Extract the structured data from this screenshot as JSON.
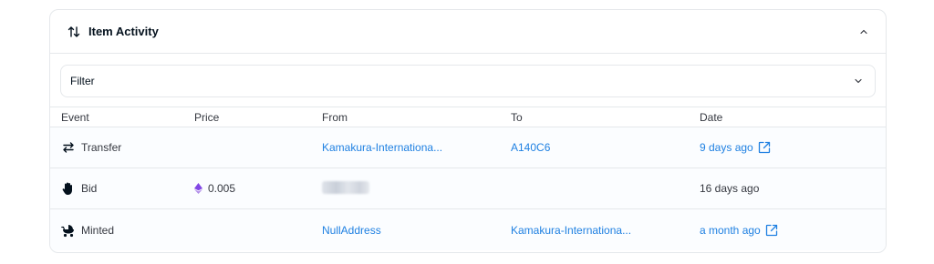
{
  "panel": {
    "title": "Item Activity",
    "header_icon": "swap-vertical-icon",
    "collapse_icon": "chevron-up-icon"
  },
  "filter": {
    "label": "Filter",
    "icon": "chevron-down-icon"
  },
  "columns": [
    "Event",
    "Price",
    "From",
    "To",
    "Date"
  ],
  "rows": [
    {
      "event": "Transfer",
      "event_icon": "transfer-arrows-icon",
      "price": "",
      "from": "Kamakura-Internationa...",
      "to": "A140C6",
      "date": "9 days ago",
      "date_has_link": true
    },
    {
      "event": "Bid",
      "event_icon": "hand-icon",
      "price": "0.005",
      "price_icon": "ethereum-icon",
      "from": "",
      "from_redacted": true,
      "to": "",
      "date": "16 days ago",
      "date_has_link": false
    },
    {
      "event": "Minted",
      "event_icon": "stroller-icon",
      "price": "",
      "from": "NullAddress",
      "to": "Kamakura-Internationa...",
      "date": "a month ago",
      "date_has_link": true
    }
  ],
  "colors": {
    "link": "#2081e2",
    "text": "#353840",
    "border": "#e5e8eb",
    "eth": "#8247e5"
  }
}
